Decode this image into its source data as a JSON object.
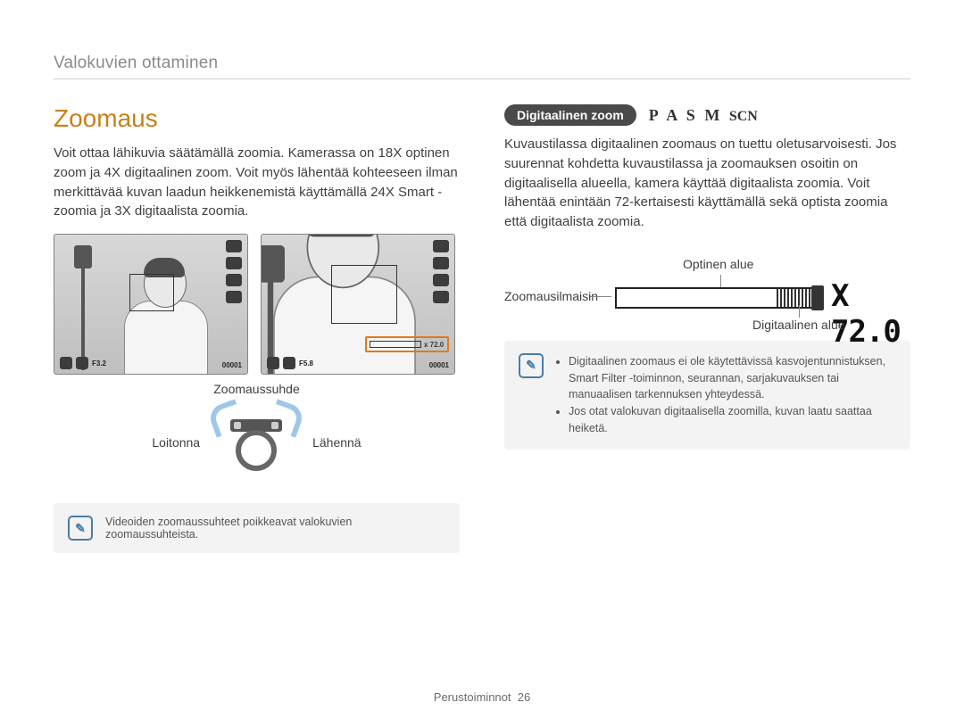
{
  "header": "Valokuvien ottaminen",
  "left": {
    "title": "Zoomaus",
    "intro": "Voit ottaa lähikuvia säätämällä zoomia. Kamerassa on 18X optinen zoom ja 4X digitaalinen zoom. Voit myös lähentää kohteeseen ilman merkittävää kuvan laadun heikkenemistä käyttämällä 24X Smart -zoomia ja 3X digitaalista zoomia.",
    "zoom_ratio_label": "Zoomaussuhde",
    "zoom_ind_value": "x 72.0",
    "zoom_out": "Loitonna",
    "zoom_in": "Lähennä",
    "note": "Videoiden zoomaussuhteet poikkeavat valokuvien zoomaussuhteista."
  },
  "right": {
    "pill": "Digitaalinen zoom",
    "modes": "P A S M",
    "modes_scn": "SCN",
    "body": "Kuvaustilassa digitaalinen zoomaus on tuettu oletusarvoisesti. Jos suurennat kohdetta kuvaustilassa ja zoomauksen osoitin on digitaalisella alueella, kamera käyttää digitaalista zoomia. Voit lähentää enintään 72-kertaisesti käyttämällä sekä optista zoomia että digitaalista zoomia.",
    "label_optical": "Optinen alue",
    "label_indicator": "Zoomausilmaisin",
    "label_digital": "Digitaalinen alue",
    "x_value": "X 72.0",
    "notes": [
      "Digitaalinen zoomaus ei ole käytettävissä kasvojentunnistuksen, Smart Filter -toiminnon, seurannan, sarjakuvauksen tai manuaalisen tarkennuksen yhteydessä.",
      "Jos otat valokuvan digitaalisella zoomilla, kuvan laatu saattaa heiketä."
    ]
  },
  "footer": {
    "section": "Perustoiminnot",
    "page": "26"
  }
}
